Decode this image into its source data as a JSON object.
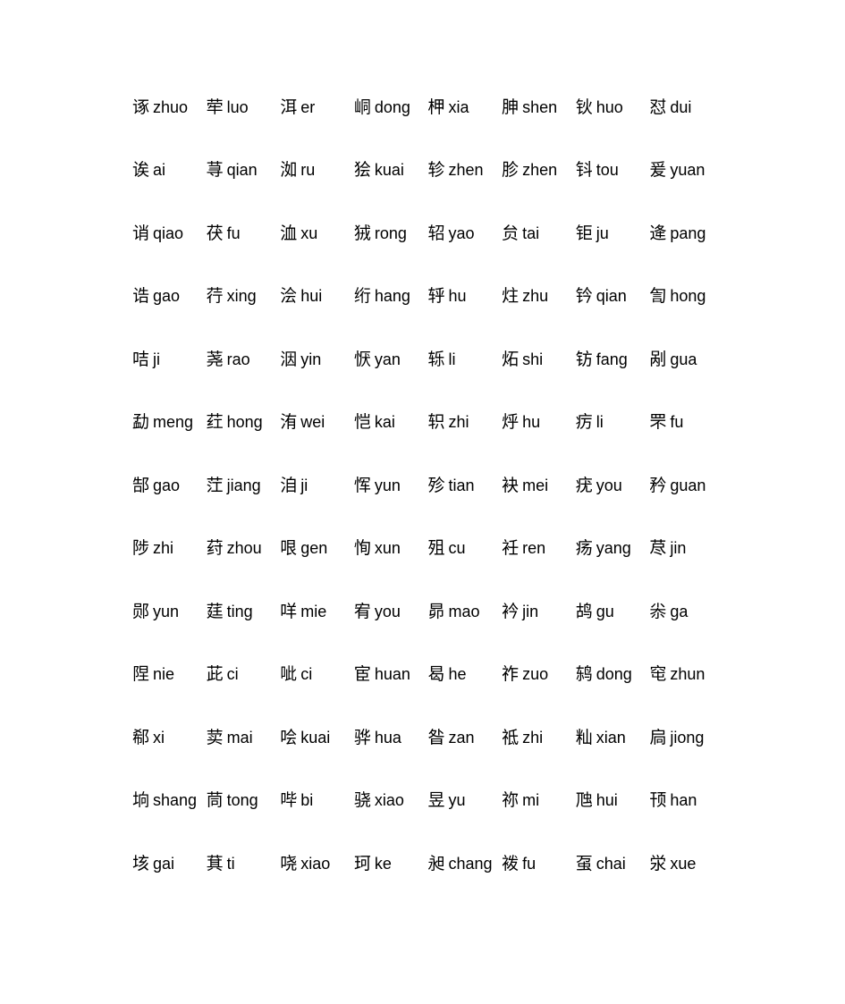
{
  "document": {
    "type": "chinese-character-pinyin-list",
    "columns": 8,
    "rows_count": 13,
    "background_color": "#ffffff",
    "text_color": "#000000"
  },
  "rows": [
    [
      {
        "hanzi": "诼",
        "pinyin": "zhuo"
      },
      {
        "hanzi": "荦",
        "pinyin": "luo"
      },
      {
        "hanzi": "洱",
        "pinyin": "er"
      },
      {
        "hanzi": "峒",
        "pinyin": "dong"
      },
      {
        "hanzi": "柙",
        "pinyin": "xia"
      },
      {
        "hanzi": "胂",
        "pinyin": "shen"
      },
      {
        "hanzi": "钬",
        "pinyin": "huo"
      },
      {
        "hanzi": "怼",
        "pinyin": "dui"
      }
    ],
    [
      {
        "hanzi": "诶",
        "pinyin": "ai"
      },
      {
        "hanzi": "荨",
        "pinyin": "qian"
      },
      {
        "hanzi": "洳",
        "pinyin": "ru"
      },
      {
        "hanzi": "狯",
        "pinyin": "kuai"
      },
      {
        "hanzi": "轸",
        "pinyin": "zhen"
      },
      {
        "hanzi": "胗",
        "pinyin": "zhen"
      },
      {
        "hanzi": "钭",
        "pinyin": "tou"
      },
      {
        "hanzi": "爰",
        "pinyin": "yuan"
      }
    ],
    [
      {
        "hanzi": "诮",
        "pinyin": "qiao"
      },
      {
        "hanzi": "茯",
        "pinyin": "fu"
      },
      {
        "hanzi": "洫",
        "pinyin": "xu"
      },
      {
        "hanzi": "狨",
        "pinyin": "rong"
      },
      {
        "hanzi": "轺",
        "pinyin": "yao"
      },
      {
        "hanzi": "贠",
        "pinyin": "tai"
      },
      {
        "hanzi": "钜",
        "pinyin": "ju"
      },
      {
        "hanzi": "逄",
        "pinyin": "pang"
      }
    ],
    [
      {
        "hanzi": "诰",
        "pinyin": "gao"
      },
      {
        "hanzi": "荇",
        "pinyin": "xing"
      },
      {
        "hanzi": "浍",
        "pinyin": "hui"
      },
      {
        "hanzi": "绗",
        "pinyin": "hang"
      },
      {
        "hanzi": "轷",
        "pinyin": "hu"
      },
      {
        "hanzi": "炷",
        "pinyin": "zhu"
      },
      {
        "hanzi": "钤",
        "pinyin": "qian"
      },
      {
        "hanzi": "訇",
        "pinyin": "hong"
      }
    ],
    [
      {
        "hanzi": "咭",
        "pinyin": "ji"
      },
      {
        "hanzi": "荛",
        "pinyin": "rao"
      },
      {
        "hanzi": "洇",
        "pinyin": "yin"
      },
      {
        "hanzi": "恹",
        "pinyin": "yan"
      },
      {
        "hanzi": "轹",
        "pinyin": "li"
      },
      {
        "hanzi": "炻",
        "pinyin": "shi"
      },
      {
        "hanzi": "钫",
        "pinyin": "fang"
      },
      {
        "hanzi": "剐",
        "pinyin": "gua"
      }
    ],
    [
      {
        "hanzi": "勐",
        "pinyin": "meng"
      },
      {
        "hanzi": "荭",
        "pinyin": "hong"
      },
      {
        "hanzi": "洧",
        "pinyin": "wei"
      },
      {
        "hanzi": "恺",
        "pinyin": "kai"
      },
      {
        "hanzi": "轵",
        "pinyin": "zhi"
      },
      {
        "hanzi": "烀",
        "pinyin": "hu"
      },
      {
        "hanzi": "疠",
        "pinyin": "li"
      },
      {
        "hanzi": "罘",
        "pinyin": "fu"
      }
    ],
    [
      {
        "hanzi": "郜",
        "pinyin": "gao"
      },
      {
        "hanzi": "茳",
        "pinyin": "jiang"
      },
      {
        "hanzi": "洎",
        "pinyin": "ji"
      },
      {
        "hanzi": "恽",
        "pinyin": "yun"
      },
      {
        "hanzi": "殄",
        "pinyin": "tian"
      },
      {
        "hanzi": "袂",
        "pinyin": "mei"
      },
      {
        "hanzi": "疣",
        "pinyin": "you"
      },
      {
        "hanzi": "矜",
        "pinyin": "guan"
      }
    ],
    [
      {
        "hanzi": "陟",
        "pinyin": "zhi"
      },
      {
        "hanzi": "荮",
        "pinyin": "zhou"
      },
      {
        "hanzi": "哏",
        "pinyin": "gen"
      },
      {
        "hanzi": "恂",
        "pinyin": "xun"
      },
      {
        "hanzi": "殂",
        "pinyin": "cu"
      },
      {
        "hanzi": "衽",
        "pinyin": "ren"
      },
      {
        "hanzi": "疡",
        "pinyin": "yang"
      },
      {
        "hanzi": "荩",
        "pinyin": "jin"
      }
    ],
    [
      {
        "hanzi": "郧",
        "pinyin": "yun"
      },
      {
        "hanzi": "莛",
        "pinyin": "ting"
      },
      {
        "hanzi": "咩",
        "pinyin": "mie"
      },
      {
        "hanzi": "宥",
        "pinyin": "you"
      },
      {
        "hanzi": "昴",
        "pinyin": "mao"
      },
      {
        "hanzi": "衿",
        "pinyin": "jin"
      },
      {
        "hanzi": "鸪",
        "pinyin": "gu"
      },
      {
        "hanzi": "尜",
        "pinyin": "ga"
      }
    ],
    [
      {
        "hanzi": "陧",
        "pinyin": "nie"
      },
      {
        "hanzi": "茈",
        "pinyin": "ci"
      },
      {
        "hanzi": "呲",
        "pinyin": "ci"
      },
      {
        "hanzi": "宦",
        "pinyin": "huan"
      },
      {
        "hanzi": "曷",
        "pinyin": "he"
      },
      {
        "hanzi": "祚",
        "pinyin": "zuo"
      },
      {
        "hanzi": "鸫",
        "pinyin": "dong"
      },
      {
        "hanzi": "窀",
        "pinyin": "zhun"
      }
    ],
    [
      {
        "hanzi": "郗",
        "pinyin": "xi"
      },
      {
        "hanzi": "荬",
        "pinyin": "mai"
      },
      {
        "hanzi": "哙",
        "pinyin": "kuai"
      },
      {
        "hanzi": "骅",
        "pinyin": "hua"
      },
      {
        "hanzi": "昝",
        "pinyin": "zan"
      },
      {
        "hanzi": "祗",
        "pinyin": "zhi"
      },
      {
        "hanzi": "籼",
        "pinyin": "xian"
      },
      {
        "hanzi": "扃",
        "pinyin": "jiong"
      }
    ],
    [
      {
        "hanzi": "垧",
        "pinyin": "shang"
      },
      {
        "hanzi": "茼",
        "pinyin": "tong"
      },
      {
        "hanzi": "哔",
        "pinyin": "bi"
      },
      {
        "hanzi": "骁",
        "pinyin": "xiao"
      },
      {
        "hanzi": "昱",
        "pinyin": "yu"
      },
      {
        "hanzi": "祢",
        "pinyin": "mi"
      },
      {
        "hanzi": "虺",
        "pinyin": "hui"
      },
      {
        "hanzi": "顸",
        "pinyin": "han"
      }
    ],
    [
      {
        "hanzi": "垓",
        "pinyin": "gai"
      },
      {
        "hanzi": "萁",
        "pinyin": "ti"
      },
      {
        "hanzi": "哓",
        "pinyin": "xiao"
      },
      {
        "hanzi": "珂",
        "pinyin": "ke"
      },
      {
        "hanzi": "昶",
        "pinyin": "chang"
      },
      {
        "hanzi": "袯",
        "pinyin": "fu"
      },
      {
        "hanzi": "虿",
        "pinyin": "chai"
      },
      {
        "hanzi": "泶",
        "pinyin": "xue"
      }
    ]
  ]
}
